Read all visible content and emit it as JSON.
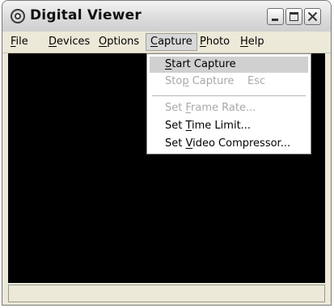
{
  "window": {
    "title": "Digital Viewer"
  },
  "menubar": {
    "file": {
      "pre": "",
      "key": "F",
      "post": "ile"
    },
    "devices": {
      "pre": "",
      "key": "D",
      "post": "evices"
    },
    "options": {
      "pre": "",
      "key": "O",
      "post": "ptions"
    },
    "capture": {
      "pre": "",
      "key": "C",
      "post": "apture"
    },
    "photo": {
      "pre": "",
      "key": "P",
      "post": "hoto"
    },
    "help": {
      "pre": "",
      "key": "H",
      "post": "elp"
    }
  },
  "capture_menu": {
    "start_capture": {
      "pre": "",
      "key": "S",
      "post": "tart Capture"
    },
    "stop_capture": {
      "pre": "Sto",
      "key": "p",
      "post": " Capture",
      "shortcut": "Esc"
    },
    "set_frame_rate": {
      "pre": "Set ",
      "key": "F",
      "post": "rame Rate..."
    },
    "set_time_limit": {
      "pre": "Set ",
      "key": "T",
      "post": "ime Limit..."
    },
    "set_video_compressor": {
      "pre": "Set ",
      "key": "V",
      "post": "ideo Compressor..."
    }
  },
  "colors": {
    "viewport": "#000000",
    "highlight": "#d0d0d0",
    "disabled_text": "#a8a8a8"
  },
  "icons": {
    "app": "webcam-icon",
    "minimize": "minimize-icon",
    "maximize": "maximize-icon",
    "close": "close-icon"
  }
}
